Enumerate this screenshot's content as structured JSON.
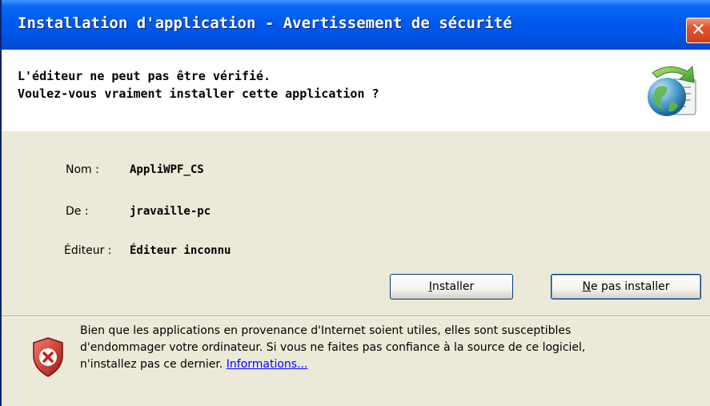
{
  "window": {
    "title": "Installation d'application - Avertissement de sécurité",
    "close_glyph": "✕",
    "close_icon": "close-icon"
  },
  "header": {
    "line1": "L'éditeur ne peut pas être vérifié.",
    "line2": "Voulez-vous vraiment installer cette application ?",
    "icon": "globe-install-icon"
  },
  "details": {
    "name_label": "Nom :",
    "name_value": "AppliWPF_CS",
    "from_label": "De :",
    "from_value": "jravaille-pc",
    "publisher_label": "Éditeur :",
    "publisher_value": "Éditeur inconnu"
  },
  "buttons": {
    "install_hotkey": "I",
    "install_rest": "nstaller",
    "noinstall_hotkey": "N",
    "noinstall_rest": "e pas installer"
  },
  "warning": {
    "icon": "shield-warning-icon",
    "line1": "Bien que les applications en provenance d'Internet soient utiles, elles sont susceptibles",
    "line2": "d'endommager votre ordinateur. Si vous ne faites pas confiance à la source de ce logiciel,",
    "line3_prefix": "n'installez pas ce dernier. ",
    "link": "Informations..."
  },
  "colors": {
    "titlebar": "#0055E5",
    "dialog_bg": "#ECE9D8",
    "close_red": "#E2542F",
    "link": "#0000FF"
  }
}
